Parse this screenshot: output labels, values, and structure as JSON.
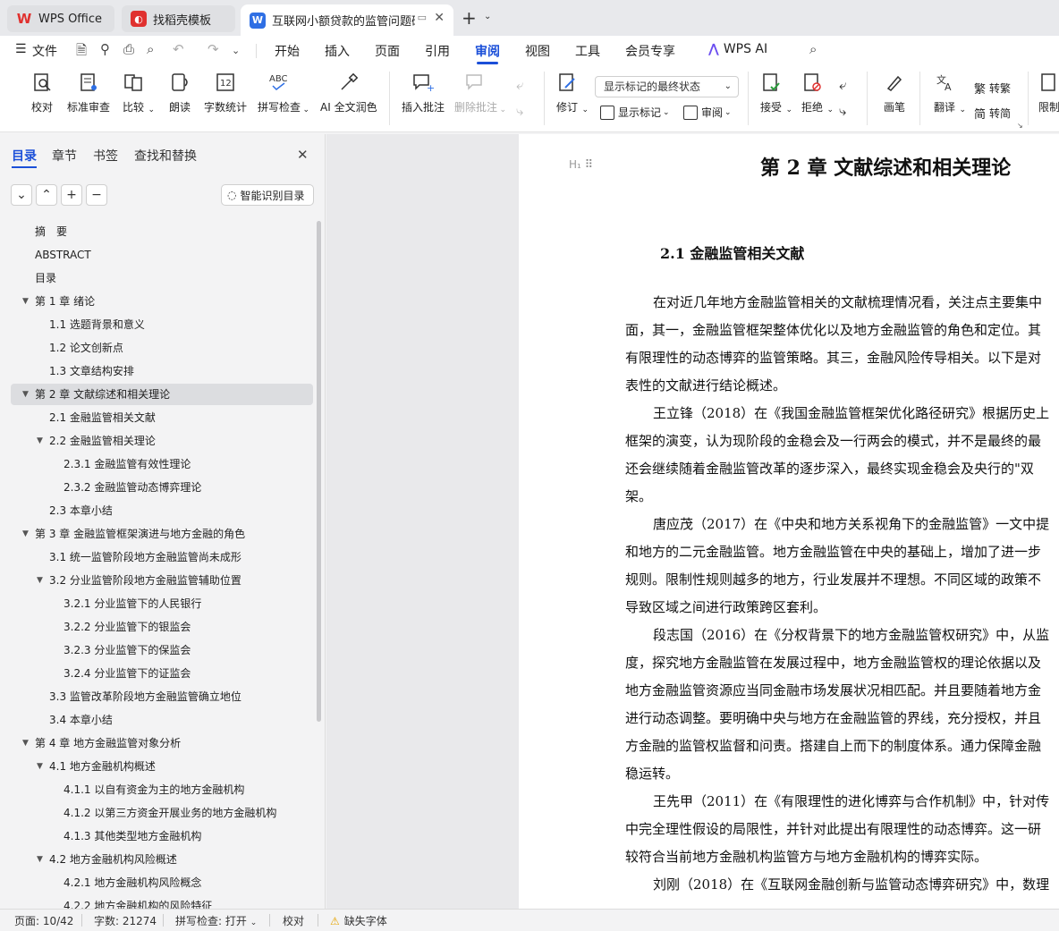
{
  "tabs": {
    "wps_office": "WPS Office",
    "template": "找稻壳模板",
    "document": "互联网小额贷款的监管问题研究",
    "new_tab": "+"
  },
  "menu": {
    "file": "文件",
    "items": [
      "开始",
      "插入",
      "页面",
      "引用",
      "审阅",
      "视图",
      "工具",
      "会员专享"
    ],
    "wps_ai": "WPS AI"
  },
  "ribbon": {
    "proofread": "校对",
    "standard_review": "标准审查",
    "compare": "比较",
    "read_aloud": "朗读",
    "word_count": "字数统计",
    "spell_check": "拼写检查",
    "ai_polish": "AI 全文润色",
    "insert_comment": "插入批注",
    "delete_comment": "删除批注",
    "revise": "修订",
    "markup_dropdown": "显示标记的最终状态",
    "show_markup": "显示标记",
    "review": "审阅",
    "accept": "接受",
    "reject": "拒绝",
    "pen": "画笔",
    "translate": "翻译",
    "to_traditional": "转繁",
    "to_simplified": "转简",
    "restrict": "限制"
  },
  "side": {
    "tabs": [
      "目录",
      "章节",
      "书签",
      "查找和替换"
    ],
    "smart_toc": "智能识别目录",
    "toc": [
      {
        "text": "摘　要",
        "level": 0,
        "caret": ""
      },
      {
        "text": "ABSTRACT",
        "level": 0,
        "caret": ""
      },
      {
        "text": "目录",
        "level": 0,
        "caret": ""
      },
      {
        "text": "第 1 章  绪论",
        "level": 0,
        "caret": "▼"
      },
      {
        "text": "1.1 选题背景和意义",
        "level": 1,
        "caret": ""
      },
      {
        "text": "1.2 论文创新点",
        "level": 1,
        "caret": ""
      },
      {
        "text": "1.3 文章结构安排",
        "level": 1,
        "caret": ""
      },
      {
        "text": "第 2 章  文献综述和相关理论",
        "level": 0,
        "caret": "▼",
        "selected": true
      },
      {
        "text": "2.1  金融监管相关文献",
        "level": 1,
        "caret": ""
      },
      {
        "text": "2.2  金融监管相关理论",
        "level": 1,
        "caret": "▼"
      },
      {
        "text": "2.3.1  金融监管有效性理论",
        "level": 2,
        "caret": ""
      },
      {
        "text": "2.3.2  金融监管动态博弈理论",
        "level": 2,
        "caret": ""
      },
      {
        "text": "2.3  本章小结",
        "level": 1,
        "caret": ""
      },
      {
        "text": "第 3 章  金融监管框架演进与地方金融的角色",
        "level": 0,
        "caret": "▼"
      },
      {
        "text": "3.1  统一监管阶段地方金融监管尚未成形",
        "level": 1,
        "caret": ""
      },
      {
        "text": "3.2  分业监管阶段地方金融监管辅助位置",
        "level": 1,
        "caret": "▼"
      },
      {
        "text": "3.2.1  分业监管下的人民银行",
        "level": 2,
        "caret": ""
      },
      {
        "text": "3.2.2  分业监管下的银监会",
        "level": 2,
        "caret": ""
      },
      {
        "text": "3.2.3  分业监管下的保监会",
        "level": 2,
        "caret": ""
      },
      {
        "text": "3.2.4  分业监管下的证监会",
        "level": 2,
        "caret": ""
      },
      {
        "text": "3.3  监管改革阶段地方金融监管确立地位",
        "level": 1,
        "caret": ""
      },
      {
        "text": "3.4  本章小结",
        "level": 1,
        "caret": ""
      },
      {
        "text": "第 4 章  地方金融监管对象分析",
        "level": 0,
        "caret": "▼"
      },
      {
        "text": "4.1  地方金融机构概述",
        "level": 1,
        "caret": "▼"
      },
      {
        "text": "4.1.1  以自有资金为主的地方金融机构",
        "level": 2,
        "caret": ""
      },
      {
        "text": "4.1.2  以第三方资金开展业务的地方金融机构",
        "level": 2,
        "caret": ""
      },
      {
        "text": "4.1.3  其他类型地方金融机构",
        "level": 2,
        "caret": ""
      },
      {
        "text": "4.2  地方金融机构风险概述",
        "level": 1,
        "caret": "▼"
      },
      {
        "text": "4.2.1  地方金融机构风险概念",
        "level": 2,
        "caret": ""
      },
      {
        "text": "4.2.2  地方金融机构的风险特征",
        "level": 2,
        "caret": ""
      }
    ]
  },
  "doc": {
    "heading_marker": "H₁",
    "chapter_title": "第 2 章  文献综述和相关理论",
    "section_title": "2.1  金融监管相关文献",
    "lines": [
      {
        "text": "在对近几年地方金融监管相关的文献梳理情况看，关注点主要集中",
        "indent": true
      },
      {
        "text": "面，其一，金融监管框架整体优化以及地方金融监管的角色和定位。其",
        "indent": false
      },
      {
        "text": "有限理性的动态博弈的监管策略。其三，金融风险传导相关。以下是对",
        "indent": false
      },
      {
        "text": "表性的文献进行结论概述。",
        "indent": false
      },
      {
        "text": "王立锋（2018）在《我国金融监管框架优化路径研究》根据历史上",
        "indent": true
      },
      {
        "text": "框架的演变，认为现阶段的金稳会及一行两会的模式，并不是最终的最",
        "indent": false
      },
      {
        "text": "还会继续随着金融监管改革的逐步深入，最终实现金稳会及央行的\"双",
        "indent": false
      },
      {
        "text": "架。",
        "indent": false
      },
      {
        "text": "唐应茂（2017）在《中央和地方关系视角下的金融监管》一文中提",
        "indent": true
      },
      {
        "text": "和地方的二元金融监管。地方金融监管在中央的基础上，增加了进一步",
        "indent": false
      },
      {
        "text": "规则。限制性规则越多的地方，行业发展并不理想。不同区域的政策不",
        "indent": false
      },
      {
        "text": "导致区域之间进行政策跨区套利。",
        "indent": false
      },
      {
        "text": "段志国（2016）在《分权背景下的地方金融监管权研究》中，从监",
        "indent": true
      },
      {
        "text": "度，探究地方金融监管在发展过程中，地方金融监管权的理论依据以及",
        "indent": false
      },
      {
        "text": "地方金融监管资源应当同金融市场发展状况相匹配。并且要随着地方金",
        "indent": false
      },
      {
        "text": "进行动态调整。要明确中央与地方在金融监管的界线，充分授权，并且",
        "indent": false
      },
      {
        "text": "方金融的监管权监督和问责。搭建自上而下的制度体系。通力保障金融",
        "indent": false
      },
      {
        "text": "稳运转。",
        "indent": false
      },
      {
        "text": "王先甲（2011）在《有限理性的进化博弈与合作机制》中，针对传",
        "indent": true
      },
      {
        "text": "中完全理性假设的局限性，并针对此提出有限理性的动态博弈。这一研",
        "indent": false
      },
      {
        "text": "较符合当前地方金融机构监管方与地方金融机构的博弈实际。",
        "indent": false
      },
      {
        "text": "刘刚（2018）在《互联网金融创新与监管动态博弈研究》中，数理",
        "indent": true
      }
    ]
  },
  "status": {
    "page": "页面: 10/42",
    "words": "字数: 21274",
    "spell": "拼写检查: 打开",
    "proof": "校对",
    "missing_font": "缺失字体"
  }
}
